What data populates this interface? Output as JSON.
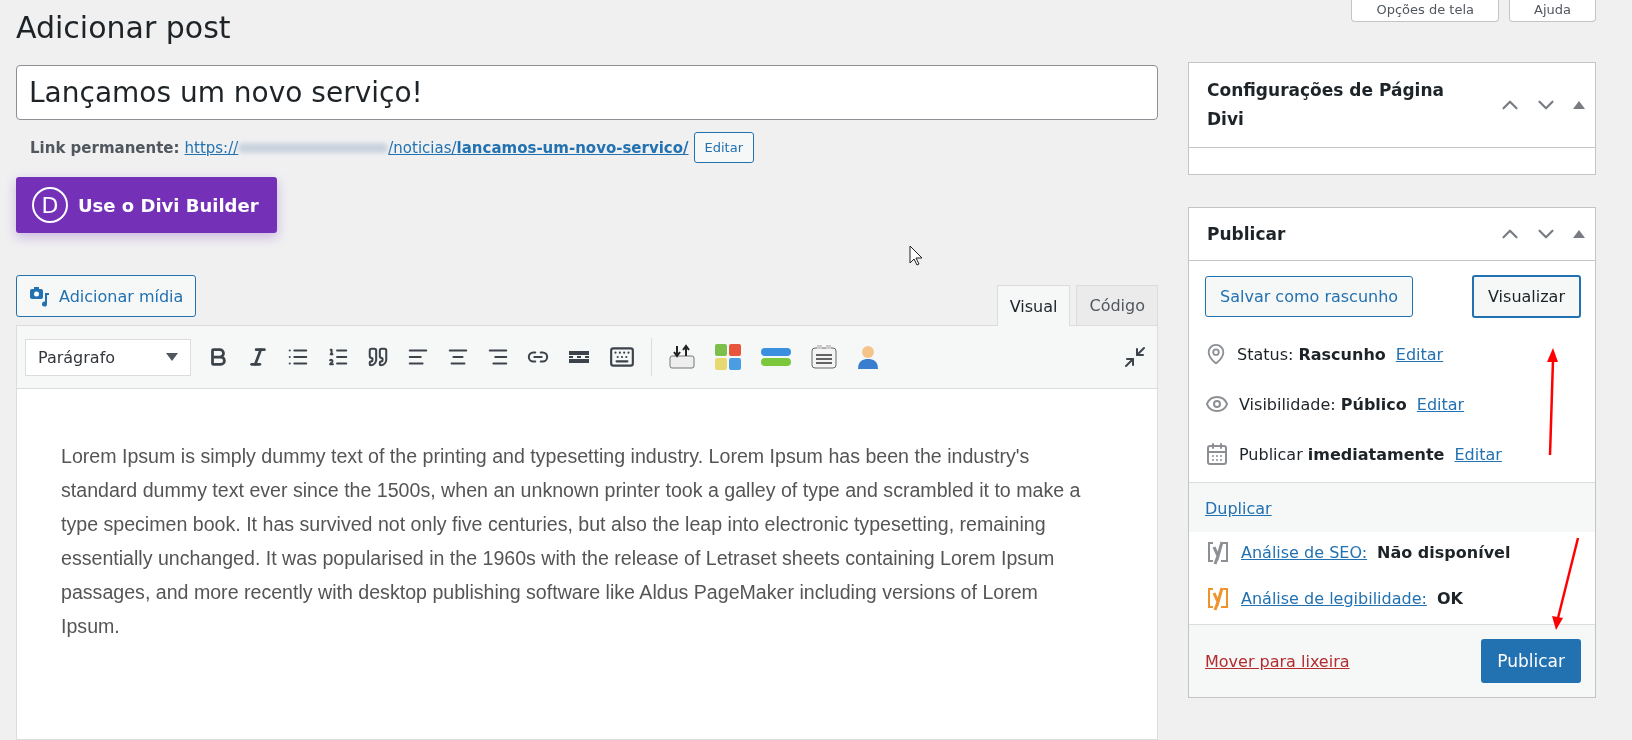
{
  "page_title": "Adicionar post",
  "screen_buttons": [
    {
      "label": "Opções de tela"
    },
    {
      "label": "Ajuda"
    }
  ],
  "post_title": "Lançamos um novo serviço!",
  "permalink": {
    "label": "Link permanente:",
    "url_prefix": "https://",
    "url_path": "/noticias/",
    "slug": "lancamos-um-novo-servico/",
    "edit_button": "Editar"
  },
  "divi_button": {
    "letter": "D",
    "label": "Use o Divi Builder"
  },
  "media_button": "Adicionar mídia",
  "editor_tabs": [
    {
      "label": "Visual",
      "selected": true
    },
    {
      "label": "Código",
      "selected": false
    }
  ],
  "format_select": "Parágrafo",
  "content": "Lorem Ipsum is simply dummy text of the printing and typesetting industry. Lorem Ipsum has been the industry's standard dummy text ever since the 1500s, when an unknown printer took a galley of type and scrambled it to make a type specimen book. It has survived not only five centuries, but also the leap into electronic typesetting, remaining essentially unchanged. It was popularised in the 1960s with the release of Letraset sheets containing Lorem Ipsum passages, and more recently with desktop publishing software like Aldus PageMaker including versions of Lorem Ipsum.",
  "divi_box": {
    "title": "Configurações de Página Divi"
  },
  "publish_box": {
    "title": "Publicar",
    "save_draft": "Salvar como rascunho",
    "preview": "Visualizar",
    "rows": [
      {
        "kind": "status",
        "label": "Status:",
        "value": "Rascunho",
        "link": "Editar"
      },
      {
        "kind": "visibility",
        "label": "Visibilidade:",
        "value": "Público",
        "link": "Editar"
      },
      {
        "kind": "schedule",
        "label": "Publicar",
        "value": "imediatamente",
        "link": "Editar"
      }
    ],
    "duplicate": "Duplicar",
    "analysis": [
      {
        "link": "Análise de SEO:",
        "value": "Não disponível",
        "color": "#8c8f94"
      },
      {
        "link": "Análise de legibilidade:",
        "value": "OK",
        "color": "#f0932b"
      }
    ],
    "trash": "Mover para lixeira",
    "publish": "Publicar"
  }
}
